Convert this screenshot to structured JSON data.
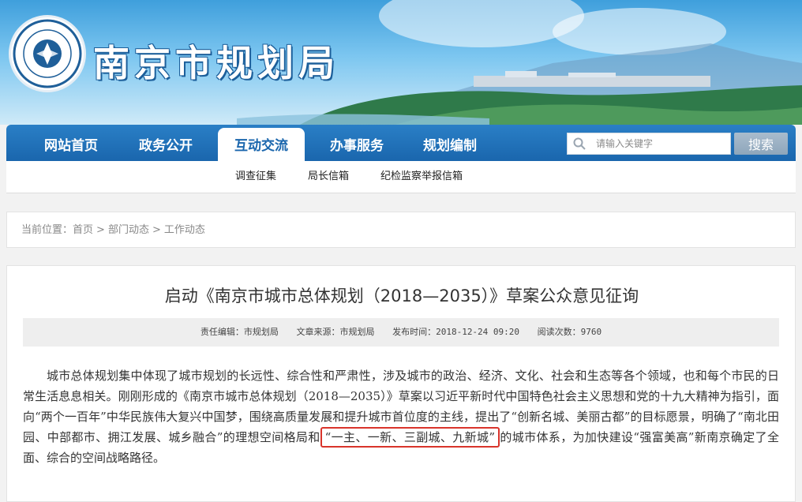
{
  "header": {
    "site_title": "南京市规划局",
    "logo": "municipal-seal-logo"
  },
  "nav": {
    "items": [
      {
        "label": "网站首页"
      },
      {
        "label": "政务公开"
      },
      {
        "label": "互动交流",
        "active": true
      },
      {
        "label": "办事服务"
      },
      {
        "label": "规划编制"
      }
    ],
    "search_placeholder": "请输入关键字",
    "search_button": "搜索"
  },
  "subnav": {
    "items": [
      {
        "label": "调查征集"
      },
      {
        "label": "局长信箱"
      },
      {
        "label": "纪检监察举报信箱"
      }
    ]
  },
  "breadcrumb": {
    "prefix": "当前位置：",
    "items": [
      "首页",
      "部门动态",
      "工作动态"
    ],
    "separator": ">"
  },
  "article": {
    "title": "启动《南京市城市总体规划（2018—2035）》草案公众意见征询",
    "meta": {
      "editor": "责任编辑：市规划局",
      "source": "文章来源：市规划局",
      "published": "发布时间：2018-12-24 09:20",
      "views": "阅读次数：9760"
    },
    "body_before": "城市总体规划集中体现了城市规划的长远性、综合性和严肃性，涉及城市的政治、经济、文化、社会和生态等各个领域，也和每个市民的日常生活息息相关。刚刚形成的《南京市城市总体规划（2018—2035）》草案以习近平新时代中国特色社会主义思想和党的十九大精神为指引，面向“两个一百年”中华民族伟大复兴中国梦，围绕高质量发展和提升城市首位度的主线，提出了“创新名城、美丽古都”的目标愿景，明确了“南北田园、中部都市、拥江发展、城乡融合”的理想空间格局和",
    "body_highlight": "“一主、一新、三副城、九新城”",
    "body_after": "的城市体系，为加快建设“强富美高”新南京确定了全面、综合的空间战略路径。"
  },
  "colors": {
    "nav_blue": "#1a66ad",
    "highlight_red": "#d9342b"
  }
}
